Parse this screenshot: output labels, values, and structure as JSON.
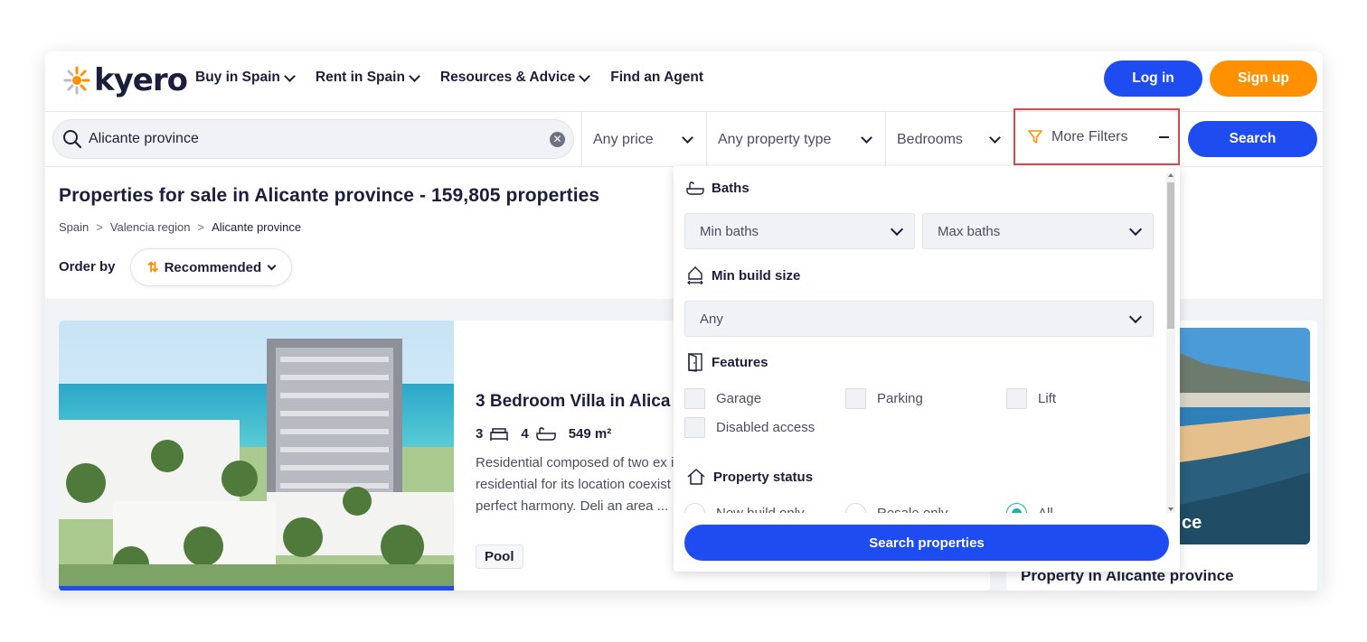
{
  "header": {
    "logo_text": "kyero",
    "nav": [
      "Buy in Spain",
      "Rent in Spain",
      "Resources & Advice",
      "Find an Agent"
    ],
    "login_label": "Log in",
    "signup_label": "Sign up"
  },
  "search": {
    "value": "Alicante province",
    "price_label": "Any price",
    "type_label": "Any property type",
    "bedrooms_label": "Bedrooms",
    "more_filters_label": "More Filters",
    "search_label": "Search"
  },
  "results": {
    "title": "Properties for sale in Alicante province - 159,805 properties",
    "breadcrumb": [
      "Spain",
      "Valencia region",
      "Alicante province"
    ],
    "order_label": "Order by",
    "order_value": "Recommended"
  },
  "card": {
    "title": "3 Bedroom Villa in Alica",
    "beds": "3",
    "baths": "4",
    "area": "549 m²",
    "description": "Residential composed of two ex iconic residential for its location coexist in perfect harmony. Deli an area ...",
    "tag": "Pool"
  },
  "card2": {
    "overlay": "ce",
    "title": "Property in Alicante province"
  },
  "panel": {
    "baths_title": "Baths",
    "min_baths": "Min baths",
    "max_baths": "Max baths",
    "build_title": "Min build size",
    "build_value": "Any",
    "features_title": "Features",
    "features": [
      "Garage",
      "Parking",
      "Lift",
      "Disabled access"
    ],
    "status_title": "Property status",
    "status_options": [
      "New build only",
      "Resale only",
      "All"
    ],
    "search_properties_label": "Search properties"
  },
  "colors": {
    "primary_blue": "#1e4cf0",
    "orange": "#ff9100",
    "highlight_red": "#e2484b",
    "teal": "#1bb4a4"
  }
}
